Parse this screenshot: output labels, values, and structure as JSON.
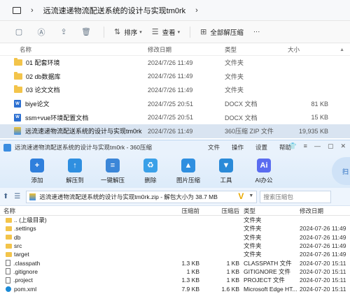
{
  "explorer": {
    "path": "远流速递物流配送系统的设计与实现tm0rk",
    "toolbar": {
      "sort": "排序",
      "view": "查看",
      "extract_all": "全部解压缩"
    },
    "columns": {
      "name": "名称",
      "date": "修改日期",
      "type": "类型",
      "size": "大小"
    },
    "rows": [
      {
        "name": "01 配套环境",
        "date": "2024/7/26 11:49",
        "type": "文件夹",
        "size": ""
      },
      {
        "name": "02 db数据库",
        "date": "2024/7/26 11:49",
        "type": "文件夹",
        "size": ""
      },
      {
        "name": "03 论文文档",
        "date": "2024/7/26 11:49",
        "type": "文件夹",
        "size": ""
      },
      {
        "name": "biye论文",
        "date": "2024/7/25 20:51",
        "type": "DOCX 文档",
        "size": "81 KB"
      },
      {
        "name": "ssm+vue环境配置文档",
        "date": "2024/7/25 20:51",
        "type": "DOCX 文档",
        "size": "15 KB"
      },
      {
        "name": "远流速递物流配送系统的设计与实现tm0rk",
        "date": "2024/7/26 11:49",
        "type": "360压缩 ZIP 文件",
        "size": "19,935 KB"
      }
    ]
  },
  "zip": {
    "title": "远流速递物流配送系统的设计与实现tm0rk - 360压缩",
    "menu": [
      "文件",
      "操作",
      "设置",
      "帮助"
    ],
    "tools": [
      {
        "label": "添加",
        "color": "#2f7fdc"
      },
      {
        "label": "解压到",
        "color": "#2f8fe0"
      },
      {
        "label": "一键解压",
        "color": "#3b86d8"
      },
      {
        "label": "删除",
        "color": "#3aa0e8"
      },
      {
        "label": "图片压缩",
        "color": "#2f8fe0"
      },
      {
        "label": "工具",
        "color": "#2a8ad8"
      },
      {
        "label": "AI办公",
        "color": "#5a6cf0"
      }
    ],
    "scan_label": "扫",
    "address": "远流速递物流配送系统的设计与实现tm0rk.zip - 解包大小为 38.7 MB",
    "search_placeholder": "搜索压缩包",
    "columns": {
      "name": "名称",
      "size": "压缩前",
      "packed": "压缩后",
      "type": "类型",
      "modified": "修改日期"
    },
    "rows": [
      {
        "name": ".. (上级目录)",
        "size": "",
        "packed": "",
        "type": "文件夹",
        "modified": "",
        "kind": "folder"
      },
      {
        "name": ".settings",
        "size": "",
        "packed": "",
        "type": "文件夹",
        "modified": "2024-07-26 11:49",
        "kind": "folder"
      },
      {
        "name": "db",
        "size": "",
        "packed": "",
        "type": "文件夹",
        "modified": "2024-07-26 11:49",
        "kind": "folder"
      },
      {
        "name": "src",
        "size": "",
        "packed": "",
        "type": "文件夹",
        "modified": "2024-07-26 11:49",
        "kind": "folder"
      },
      {
        "name": "target",
        "size": "",
        "packed": "",
        "type": "文件夹",
        "modified": "2024-07-26 11:49",
        "kind": "folder"
      },
      {
        "name": ".classpath",
        "size": "1.3 KB",
        "packed": "1 KB",
        "type": "CLASSPATH 文件",
        "modified": "2024-07-20 15:11",
        "kind": "doc"
      },
      {
        "name": ".gitignore",
        "size": "1 KB",
        "packed": "1 KB",
        "type": "GITIGNORE 文件",
        "modified": "2024-07-20 15:11",
        "kind": "doc"
      },
      {
        "name": ".project",
        "size": "1.3 KB",
        "packed": "1 KB",
        "type": "PROJECT 文件",
        "modified": "2024-07-20 15:11",
        "kind": "doc"
      },
      {
        "name": "pom.xml",
        "size": "7.9 KB",
        "packed": "1.6 KB",
        "type": "Microsoft Edge HT...",
        "modified": "2024-07-20 15:11",
        "kind": "edge"
      }
    ]
  }
}
